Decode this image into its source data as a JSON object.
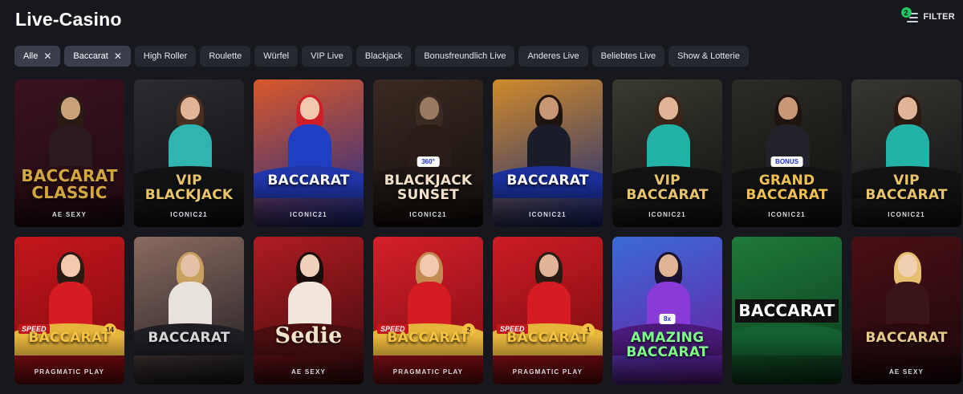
{
  "page": {
    "title": "Live-Casino"
  },
  "filter": {
    "label": "FILTER",
    "badge": "2"
  },
  "chips": [
    {
      "label": "Alle",
      "active": true,
      "removable": true
    },
    {
      "label": "Baccarat",
      "active": true,
      "removable": true
    },
    {
      "label": "High Roller",
      "active": false,
      "removable": false
    },
    {
      "label": "Roulette",
      "active": false,
      "removable": false
    },
    {
      "label": "Würfel",
      "active": false,
      "removable": false
    },
    {
      "label": "VIP Live",
      "active": false,
      "removable": false
    },
    {
      "label": "Blackjack",
      "active": false,
      "removable": false
    },
    {
      "label": "Bonusfreundlich Live",
      "active": false,
      "removable": false
    },
    {
      "label": "Anderes Live",
      "active": false,
      "removable": false
    },
    {
      "label": "Beliebtes Live",
      "active": false,
      "removable": false
    },
    {
      "label": "Show & Lotterie",
      "active": false,
      "removable": false
    }
  ],
  "games": [
    {
      "name": "BACCARAT CLASSIC",
      "provider": "AE SEXY",
      "bg": [
        "#3a1220",
        "#1d0a10"
      ],
      "accent": "#d4a640",
      "dealer": "#c9a27a",
      "hair": "#2a1a14",
      "outfit": "#2b1b1e",
      "table": "#2a0d14",
      "style": "big",
      "badge": ""
    },
    {
      "name": "VIP BLACKJACK",
      "provider": "ICONIC21",
      "bg": [
        "#2b2c30",
        "#0d0e10"
      ],
      "accent": "#e9c46a",
      "dealer": "#e0b596",
      "hair": "#4a2e20",
      "outfit": "#2fb4b0",
      "table": "#111214",
      "style": "",
      "badge": ""
    },
    {
      "name": "BACCARAT",
      "provider": "ICONIC21",
      "bg": [
        "#d9582a",
        "#1a2a8a"
      ],
      "accent": "#ffffff",
      "dealer": "#f0c9ae",
      "hair": "#d11f2a",
      "outfit": "#1f3ec2",
      "table": "#1f35a8",
      "style": "",
      "badge": ""
    },
    {
      "name": "BLACKJACK Sunset",
      "provider": "ICONIC21",
      "bg": [
        "#3a2a22",
        "#120d0a"
      ],
      "accent": "#f4e2c8",
      "dealer": "#9b7a62",
      "hair": "#3a2a22",
      "outfit": "#2a1d17",
      "table": "#1c1512",
      "style": "",
      "badge": "360°"
    },
    {
      "name": "BACCARAT",
      "provider": "ICONIC21",
      "bg": [
        "#d08a2a",
        "#14287a"
      ],
      "accent": "#ffffff",
      "dealer": "#c99676",
      "hair": "#1f140e",
      "outfit": "#1a1c2a",
      "table": "#1a2f9a",
      "style": "",
      "badge": ""
    },
    {
      "name": "VIP BACCARAT",
      "provider": "ICONIC21",
      "bg": [
        "#3a3a30",
        "#0f0f0f"
      ],
      "accent": "#e9c46a",
      "dealer": "#e0b596",
      "hair": "#3b2418",
      "outfit": "#23b3a6",
      "table": "#121212",
      "style": "",
      "badge": ""
    },
    {
      "name": "GRAND BACCARAT",
      "provider": "ICONIC21",
      "bg": [
        "#2c2b25",
        "#0f0e0c"
      ],
      "accent": "#f0c050",
      "dealer": "#c99676",
      "hair": "#1f140e",
      "outfit": "#22232a",
      "table": "#121212",
      "style": "",
      "badge": "BONUS"
    },
    {
      "name": "VIP BACCARAT",
      "provider": "ICONIC21",
      "bg": [
        "#383632",
        "#0f0f0f"
      ],
      "accent": "#e9c46a",
      "dealer": "#e0b596",
      "hair": "#2a1a12",
      "outfit": "#23b3a6",
      "table": "#121212",
      "style": "",
      "badge": ""
    },
    {
      "name": "BACCARAT",
      "provider": "PRAGMATIC PLAY",
      "bg": [
        "#c4161c",
        "#7a0a0e"
      ],
      "accent": "#f5c242",
      "dealer": "#f0c9ae",
      "hair": "#2a1a14",
      "outfit": "#d41c22",
      "table": "#e6b53c",
      "style": "speed",
      "badge": "14"
    },
    {
      "name": "BACCARAT",
      "provider": "",
      "bg": [
        "#8a6a60",
        "#1b1b1f"
      ],
      "accent": "#d6d6d6",
      "dealer": "#e3c0a6",
      "hair": "#c8a060",
      "outfit": "#e8e2dc",
      "table": "#1d1d22",
      "style": "",
      "badge": ""
    },
    {
      "name": "Sedie",
      "provider": "AE SEXY",
      "bg": [
        "#b01c22",
        "#3a0a0c"
      ],
      "accent": "#f0e0c4",
      "dealer": "#f0d2bc",
      "hair": "#1a0d0a",
      "outfit": "#f0e6dc",
      "table": "#4a0e10",
      "style": "serif",
      "badge": ""
    },
    {
      "name": "BACCARAT",
      "provider": "PRAGMATIC PLAY",
      "bg": [
        "#d4202a",
        "#7a0a10"
      ],
      "accent": "#f5c242",
      "dealer": "#f0c9ae",
      "hair": "#c08a50",
      "outfit": "#d41c22",
      "table": "#e6b53c",
      "style": "speed",
      "badge": "2"
    },
    {
      "name": "BACCARAT",
      "provider": "PRAGMATIC PLAY",
      "bg": [
        "#cc1c24",
        "#700a0e"
      ],
      "accent": "#f5c242",
      "dealer": "#e0b596",
      "hair": "#2a1a14",
      "outfit": "#d41c22",
      "table": "#e6b53c",
      "style": "speed",
      "badge": "1"
    },
    {
      "name": "AMAZING BACCARAT",
      "provider": "",
      "bg": [
        "#3b6bd6",
        "#6a1aa0"
      ],
      "accent": "#7dff8a",
      "dealer": "#e0b596",
      "hair": "#1a1030",
      "outfit": "#8a3ad6",
      "table": "#4a1a7a",
      "style": "",
      "badge": "8x"
    },
    {
      "name": "BACCARAT",
      "provider": "",
      "bg": [
        "#1e7a3a",
        "#0c3a1a"
      ],
      "accent": "#ffffff",
      "dealer": "#1e7a3a",
      "hair": "#1e7a3a",
      "outfit": "#1e7a3a",
      "table": "#146030",
      "style": "flat",
      "badge": ""
    },
    {
      "name": "BACCARAT",
      "provider": "AE SEXY",
      "bg": [
        "#4a1016",
        "#1a0609"
      ],
      "accent": "#e7c98a",
      "dealer": "#f0d0b0",
      "hair": "#e6c070",
      "outfit": "#3a1418",
      "table": "#2a0a0e",
      "style": "",
      "badge": ""
    }
  ]
}
